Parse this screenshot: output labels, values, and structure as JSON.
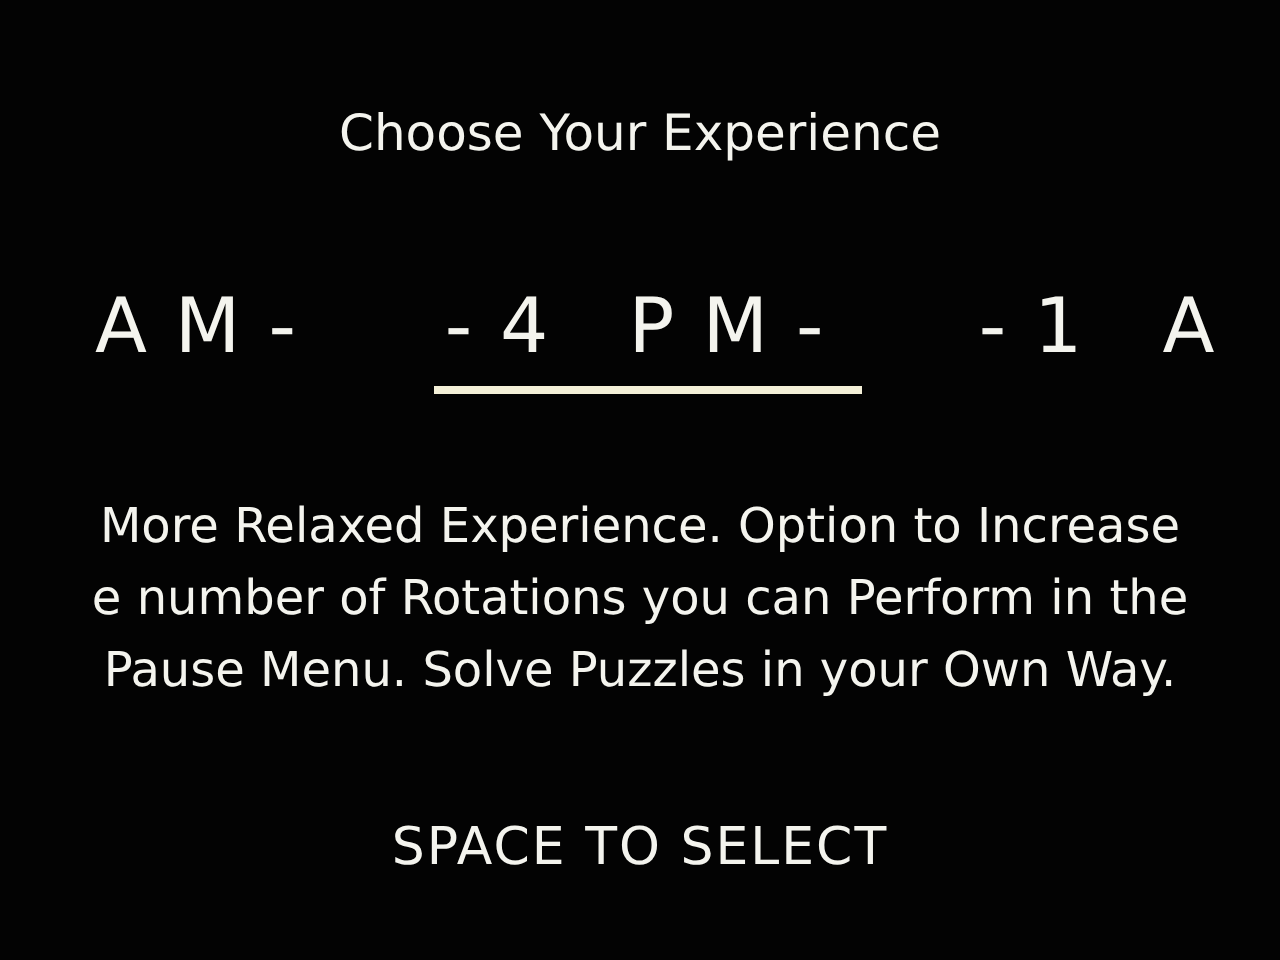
{
  "title": "Choose Your Experience",
  "options": [
    {
      "label": "AM-",
      "selected": false
    },
    {
      "label": "-4 PM-",
      "selected": true
    },
    {
      "label": "-1 A",
      "selected": false
    }
  ],
  "description": [
    "More Relaxed Experience. Option to Increase",
    "e number of Rotations you can Perform in the",
    "Pause Menu. Solve Puzzles in your Own Way."
  ],
  "prompt": "SPACE TO SELECT"
}
